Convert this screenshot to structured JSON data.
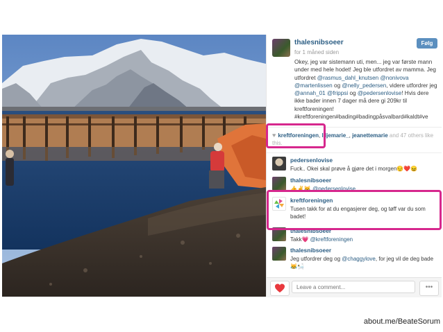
{
  "post": {
    "username": "thalesnibsoeer",
    "time_ago": "for 1 måned siden",
    "follow_label": "Følg",
    "caption_parts": [
      {
        "t": "Okey, jeg var sistemann uti, men... jeg var første mann under med hele hodet! Jeg ble utfordret av mamma. Jeg utfordret ",
        "tag": false
      },
      {
        "t": "@rasmus_dahl_knutsen",
        "tag": true
      },
      {
        "t": " ",
        "tag": false
      },
      {
        "t": "@nonivova",
        "tag": true
      },
      {
        "t": " ",
        "tag": false
      },
      {
        "t": "@martenlissen",
        "tag": true
      },
      {
        "t": " og ",
        "tag": false
      },
      {
        "t": "@nelly_pedersen",
        "tag": true
      },
      {
        "t": ", videre utfordrer jeg ",
        "tag": false
      },
      {
        "t": "@annah_01",
        "tag": true
      },
      {
        "t": " ",
        "tag": false
      },
      {
        "t": "@frippsi",
        "tag": true
      },
      {
        "t": " og ",
        "tag": false
      },
      {
        "t": "@pedersenlovise",
        "tag": true
      },
      {
        "t": "! Hvis dere ikke bader innen 7 dager må dere gi 209kr til kreftforeningen! #kreftforeningen#bading#badingpåsvalbard#kaldt#ve",
        "tag": false
      }
    ]
  },
  "likes": {
    "user1": "kreftforeningen",
    "user2": "liljemarie_",
    "user3": "jeanettemarie",
    "rest": "and 47 others like this."
  },
  "comments": [
    {
      "name": "pedersenlovise",
      "text": "Fuck.. Okei skal prøve å gjøre det i morgen😔❤️😖",
      "mention": ""
    },
    {
      "name": "thalesnibsoeer",
      "text": "👍✌😹 ",
      "mention": "@pedersenlovise"
    },
    {
      "name": "kreftforeningen",
      "text": "Tusen takk for at du engasjerer deg, og tøff var du som badet!",
      "mention": ""
    },
    {
      "name": "thalesnibsoeer",
      "text": "Takk💗 ",
      "mention": "@kreftforeningen"
    },
    {
      "name": "thalesnibsoeer",
      "text": "Jeg utfordrer deg og ",
      "mention": "@chaggylove",
      "after": ", for jeg vil de deg bade😹🛀"
    }
  ],
  "comment_box": {
    "placeholder": "Leave a comment..."
  },
  "more_label": "•••",
  "footer": "about.me/BeateSorum",
  "colors": {
    "link": "#2b5d83",
    "highlight": "#d6278d",
    "follow": "#5b8fbf",
    "like": "#e8383d"
  }
}
